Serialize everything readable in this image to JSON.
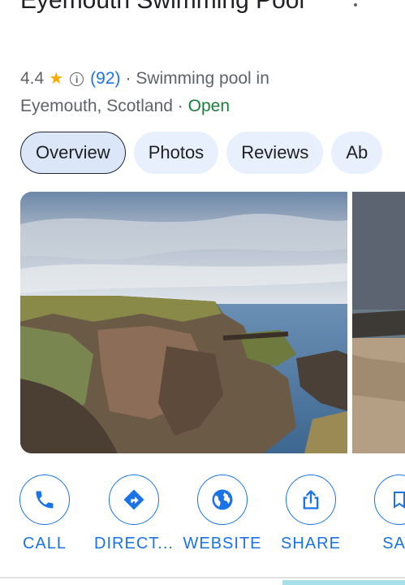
{
  "place": {
    "title": "Eyemouth Swimming Pool",
    "rating": "4.4",
    "review_count": "(92)",
    "category_prefix": "· Swimming pool in",
    "location": "Eyemouth, Scotland ·",
    "status": "Open"
  },
  "tabs": [
    {
      "label": "Overview",
      "active": true
    },
    {
      "label": "Photos",
      "active": false
    },
    {
      "label": "Reviews",
      "active": false
    },
    {
      "label": "Ab",
      "active": false
    }
  ],
  "actions": [
    {
      "label": "CALL",
      "icon": "phone-icon"
    },
    {
      "label": "DIRECT...",
      "icon": "directions-icon"
    },
    {
      "label": "WEBSITE",
      "icon": "globe-icon"
    },
    {
      "label": "SHARE",
      "icon": "share-icon"
    },
    {
      "label": "SAV",
      "icon": "bookmark-icon"
    }
  ],
  "colors": {
    "accent": "#1a73e8",
    "open": "#188038",
    "star": "#f9ab00",
    "tab_bg": "#e8f0fe"
  }
}
